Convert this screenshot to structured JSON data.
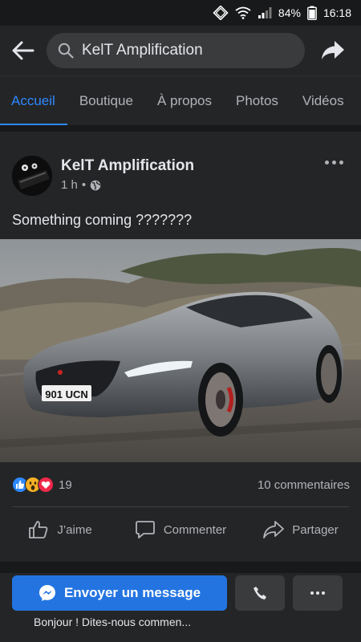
{
  "status": {
    "battery": "84%",
    "time": "16:18"
  },
  "header": {
    "search_text": "KelT Amplification"
  },
  "tabs": [
    {
      "label": "Accueil",
      "active": true
    },
    {
      "label": "Boutique"
    },
    {
      "label": "À propos"
    },
    {
      "label": "Photos"
    },
    {
      "label": "Vidéos"
    }
  ],
  "post": {
    "author": "KelT Amplification",
    "time": "1 h",
    "visibility_icon": "globe-icon",
    "text": "Something coming ???????",
    "image": {
      "plate": "901 UCN"
    },
    "reaction_count": "19",
    "comments_label": "10 commentaires",
    "actions": {
      "like": "J’aime",
      "comment": "Commenter",
      "share": "Partager"
    }
  },
  "cta": {
    "message_label": "Envoyer un message",
    "hint": "Bonjour ! Dites-nous commen..."
  },
  "colors": {
    "accent": "#2d88ff",
    "button": "#2374e1",
    "surface": "#242526",
    "background": "#18191a"
  }
}
